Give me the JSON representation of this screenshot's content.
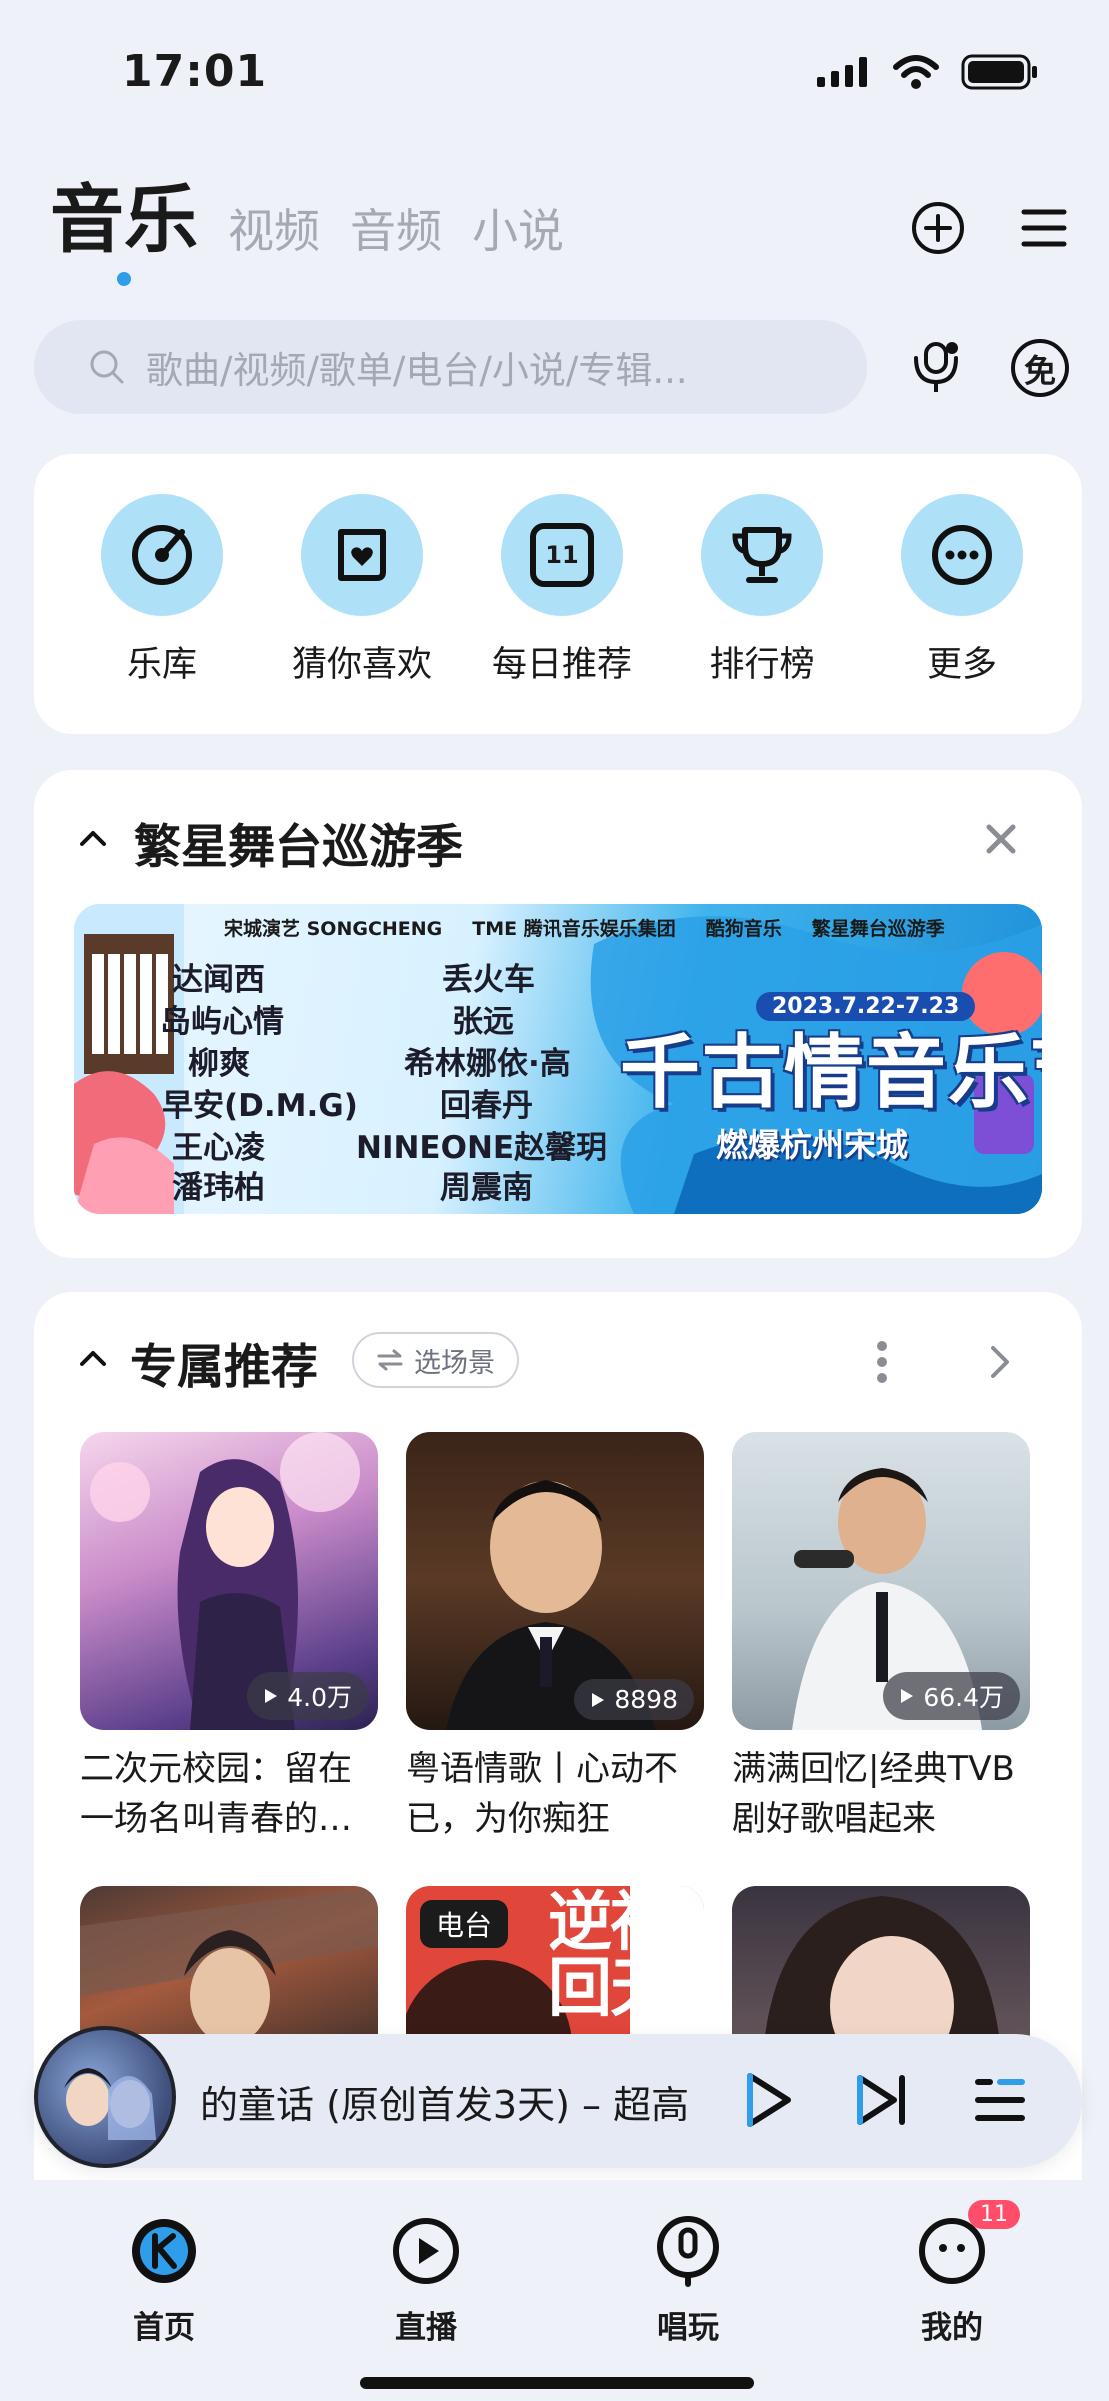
{
  "status_bar": {
    "time": "17:01"
  },
  "header": {
    "tabs": [
      {
        "label": "音乐",
        "active": true
      },
      {
        "label": "视频",
        "active": false
      },
      {
        "label": "音频",
        "active": false
      },
      {
        "label": "小说",
        "active": false
      }
    ]
  },
  "search": {
    "placeholder": "歌曲/视频/歌单/电台/小说/专辑..."
  },
  "free_icon_text": "免",
  "quick_entries": [
    {
      "label": "乐库",
      "icon": "music-disc-icon"
    },
    {
      "label": "猜你喜欢",
      "icon": "heart-card-icon"
    },
    {
      "label": "每日推荐",
      "icon": "calendar-icon",
      "badge": "11"
    },
    {
      "label": "排行榜",
      "icon": "trophy-icon"
    },
    {
      "label": "更多",
      "icon": "more-icon"
    }
  ],
  "tour": {
    "title": "繁星舞台巡游季",
    "banner": {
      "logos": [
        "宋城演艺 SONGCHENG",
        "TME 腾讯音乐娱乐集团",
        "酷狗音乐",
        "繁星舞台巡游季"
      ],
      "artists_left": [
        "达闻西",
        "岛屿心情",
        "柳爽",
        "早安(D.M.G)",
        "王心凌",
        "潘玮柏"
      ],
      "artists_right": [
        "丢火车",
        "张远",
        "希林娜依·高",
        "回春丹",
        "NINEONE赵馨玥",
        "周震南"
      ],
      "date": "2023.7.22-7.23",
      "headline": "千古情音乐节",
      "subline": "燃爆杭州宋城"
    }
  },
  "recommend": {
    "title": "专属推荐",
    "scene_chip": "选场景",
    "tiles": [
      {
        "title": "二次元校园：留在一场名叫青春的…",
        "plays": "4.0万"
      },
      {
        "title": "粤语情歌丨心动不已，为你痴狂",
        "plays": "8898"
      },
      {
        "title": "满满回忆|经典TVB剧好歌唱起来",
        "plays": "66.4万"
      }
    ],
    "tiles_row2": [
      {
        "tag": ""
      },
      {
        "tag": "电台",
        "art_text": "逆神回天"
      },
      {
        "tag": ""
      }
    ]
  },
  "mini_player": {
    "title": "的童话 (原创首发3天) – 超高"
  },
  "bottom_nav": [
    {
      "label": "首页",
      "icon": "home-k-icon",
      "active": true
    },
    {
      "label": "直播",
      "icon": "live-play-icon"
    },
    {
      "label": "唱玩",
      "icon": "sing-mic-icon"
    },
    {
      "label": "我的",
      "icon": "profile-face-icon",
      "badge": "11"
    }
  ],
  "colors": {
    "accent": "#2e9dea",
    "quick_circle": "#aee1f7",
    "badge": "#ff4d6a",
    "page_bg": "#eef1f8"
  }
}
